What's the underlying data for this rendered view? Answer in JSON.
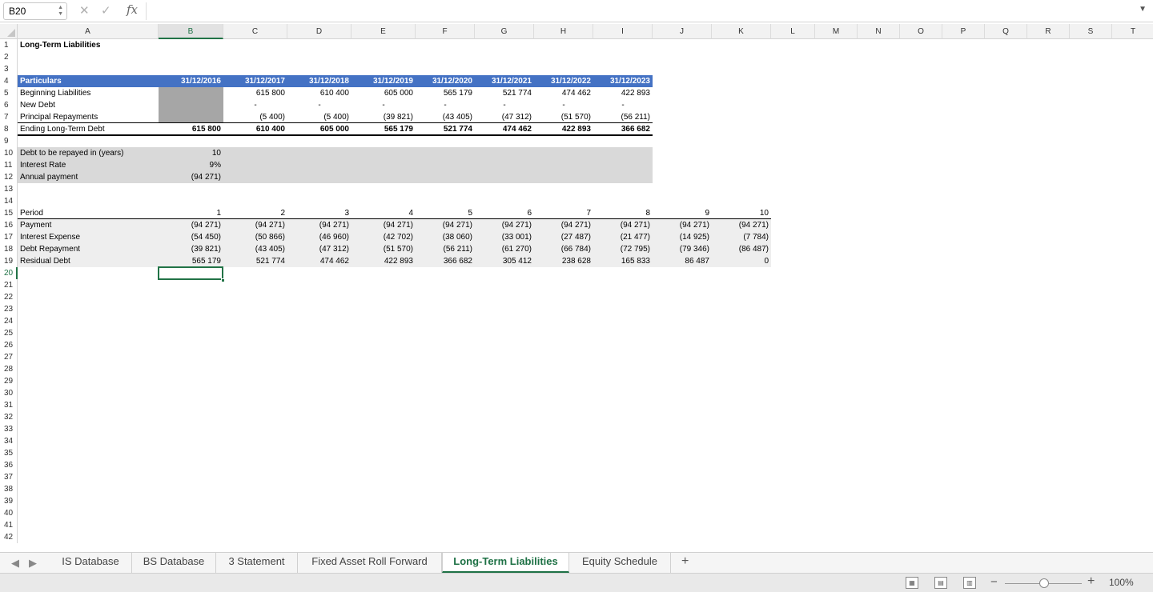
{
  "formula_bar": {
    "name_box": "B20",
    "cancel_icon": "cancel-icon",
    "enter_icon": "check-icon",
    "fx_label": "fx",
    "formula": ""
  },
  "columns": [
    "A",
    "B",
    "C",
    "D",
    "E",
    "F",
    "G",
    "H",
    "I",
    "J",
    "K",
    "L",
    "M",
    "N",
    "O",
    "P",
    "Q",
    "R",
    "S",
    "T"
  ],
  "rows": [
    "1",
    "2",
    "3",
    "4",
    "5",
    "6",
    "7",
    "8",
    "9",
    "10",
    "11",
    "12",
    "13",
    "14",
    "15",
    "16",
    "17",
    "18",
    "19",
    "20",
    "21",
    "22",
    "23",
    "24",
    "25",
    "26",
    "27",
    "28",
    "29",
    "30",
    "31",
    "32",
    "33",
    "34",
    "35",
    "36",
    "37",
    "38",
    "39",
    "40",
    "41",
    "42"
  ],
  "selected_cell": {
    "column": "B",
    "row": "20"
  },
  "sheet": {
    "title": "Long-Term Liabilities",
    "schedule": {
      "headers": [
        "Particulars",
        "31/12/2016",
        "31/12/2017",
        "31/12/2018",
        "31/12/2019",
        "31/12/2020",
        "31/12/2021",
        "31/12/2022",
        "31/12/2023"
      ],
      "rows": [
        [
          "Beginning Liabilities",
          "",
          "615 800",
          "610 400",
          "605 000",
          "565 179",
          "521 774",
          "474 462",
          "422 893"
        ],
        [
          "New Debt",
          "",
          "-",
          "-",
          "-",
          "-",
          "-",
          "-",
          "-"
        ],
        [
          "Principal Repayments",
          "",
          "(5 400)",
          "(5 400)",
          "(39 821)",
          "(43 405)",
          "(47 312)",
          "(51 570)",
          "(56 211)"
        ],
        [
          "Ending Long-Term Debt",
          "615 800",
          "610 400",
          "605 000",
          "565 179",
          "521 774",
          "474 462",
          "422 893",
          "366 682"
        ]
      ]
    },
    "assumptions": [
      [
        "Debt to be repayed in (years)",
        "10"
      ],
      [
        "Interest Rate",
        "9%"
      ],
      [
        "Annual payment",
        "(94 271)"
      ]
    ],
    "amortization": {
      "headers": [
        "Period",
        "1",
        "2",
        "3",
        "4",
        "5",
        "6",
        "7",
        "8",
        "9",
        "10"
      ],
      "rows": [
        [
          "Payment",
          "(94 271)",
          "(94 271)",
          "(94 271)",
          "(94 271)",
          "(94 271)",
          "(94 271)",
          "(94 271)",
          "(94 271)",
          "(94 271)",
          "(94 271)"
        ],
        [
          "Interest Expense",
          "(54 450)",
          "(50 866)",
          "(46 960)",
          "(42 702)",
          "(38 060)",
          "(33 001)",
          "(27 487)",
          "(21 477)",
          "(14 925)",
          "(7 784)"
        ],
        [
          "Debt Repayment",
          "(39 821)",
          "(43 405)",
          "(47 312)",
          "(51 570)",
          "(56 211)",
          "(61 270)",
          "(66 784)",
          "(72 795)",
          "(79 346)",
          "(86 487)"
        ],
        [
          "Residual Debt",
          "565 179",
          "521 774",
          "474 462",
          "422 893",
          "366 682",
          "305 412",
          "238 628",
          "165 833",
          "86 487",
          "0"
        ]
      ]
    }
  },
  "tabs": [
    "IS Database",
    "BS Database",
    "3 Statement",
    "Fixed Asset Roll Forward",
    "Long-Term Liabilities",
    "Equity Schedule"
  ],
  "active_tab": "Long-Term Liabilities",
  "status_bar": {
    "zoom": "100%"
  },
  "colors": {
    "header_blue": "#4472c4",
    "band_gray": "#d9d9d9",
    "dark_gray": "#a6a6a6",
    "accent_green": "#217346"
  }
}
